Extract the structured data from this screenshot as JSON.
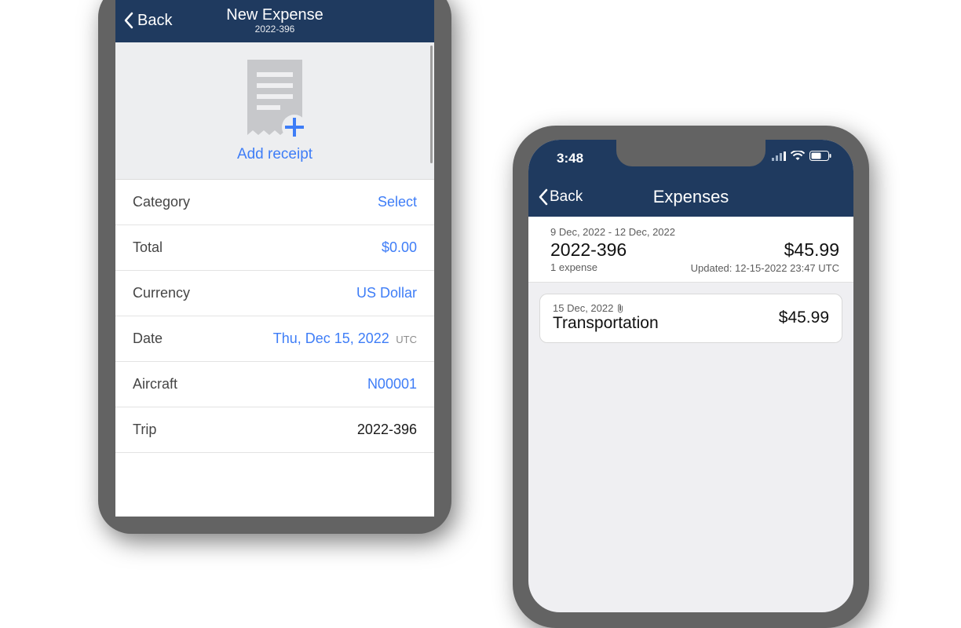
{
  "left": {
    "nav": {
      "back": "Back",
      "title": "New Expense",
      "subtitle": "2022-396"
    },
    "add_receipt": "Add receipt",
    "rows": {
      "category": {
        "label": "Category",
        "value": "Select"
      },
      "total": {
        "label": "Total",
        "value": "$0.00"
      },
      "currency": {
        "label": "Currency",
        "value": "US Dollar"
      },
      "date": {
        "label": "Date",
        "value": "Thu, Dec 15, 2022",
        "tz": "UTC"
      },
      "aircraft": {
        "label": "Aircraft",
        "value": "N00001"
      },
      "trip": {
        "label": "Trip",
        "value": "2022-396"
      }
    }
  },
  "right": {
    "statusbar": {
      "time": "3:48"
    },
    "nav": {
      "back": "Back",
      "title": "Expenses"
    },
    "summary": {
      "range": "9 Dec, 2022 - 12 Dec, 2022",
      "code": "2022-396",
      "count": "1 expense",
      "amount": "$45.99",
      "updated": "Updated: 12-15-2022 23:47 UTC"
    },
    "item": {
      "date": "15 Dec, 2022",
      "name": "Transportation",
      "amount": "$45.99"
    }
  }
}
